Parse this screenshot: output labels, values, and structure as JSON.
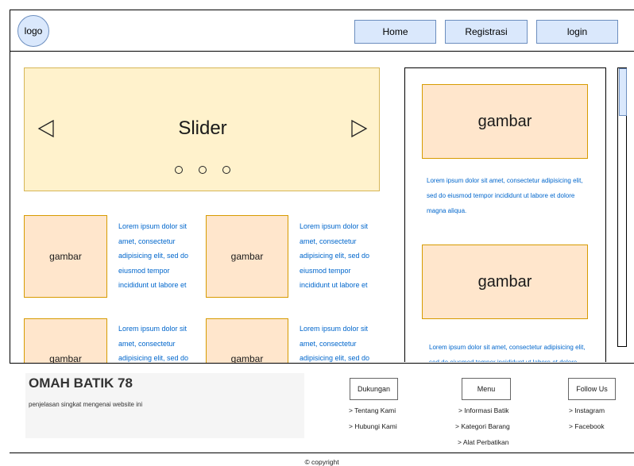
{
  "header": {
    "logo": "logo",
    "nav": {
      "home": "Home",
      "registrasi": "Registrasi",
      "login": "login"
    }
  },
  "slider": {
    "title": "Slider"
  },
  "grid": {
    "items": [
      {
        "image": "gambar",
        "text": "Lorem ipsum dolor sit amet, consectetur adipisicing elit, sed do eiusmod tempor incididunt ut labore et"
      },
      {
        "image": "gambar",
        "text": "Lorem ipsum dolor sit amet, consectetur adipisicing elit, sed do eiusmod tempor incididunt ut labore et"
      },
      {
        "image": "gambar",
        "text": "Lorem ipsum dolor sit amet, consectetur adipisicing elit, sed do eiusmod tempor incididunt ut labore et"
      },
      {
        "image": "gambar",
        "text": "Lorem ipsum dolor sit amet, consectetur adipisicing elit, sed do eiusmod tempor incididunt ut labore et"
      }
    ]
  },
  "sidebar": {
    "items": [
      {
        "image": "gambar",
        "text": "Lorem ipsum dolor sit amet, consectetur adipisicing elit, sed do eiusmod tempor incididunt ut labore et dolore magna aliqua."
      },
      {
        "image": "gambar",
        "text": "Lorem ipsum dolor sit amet, consectetur adipisicing elit, sed do eiusmod tempor incididunt ut labore et dolore magna aliqua."
      }
    ]
  },
  "footer": {
    "brand": "OMAH BATIK 78",
    "description": "penjelasan singkat mengenai website ini",
    "dukungan": {
      "title": "Dukungan",
      "links": [
        "> Tentang Kami",
        "> Hubungi Kami"
      ]
    },
    "menu": {
      "title": "Menu",
      "links": [
        "> Informasi Batik",
        "> Kategori Barang",
        "> Alat Perbatikan"
      ]
    },
    "follow": {
      "title": "Follow Us",
      "links": [
        "> Instagram",
        "> Facebook"
      ]
    },
    "copyright": "© copyright"
  },
  "colors": {
    "nav_fill": "#dae8fc",
    "slider_fill": "#fff2cc",
    "image_fill": "#ffe6cc",
    "lorem_text": "#0066cc"
  }
}
